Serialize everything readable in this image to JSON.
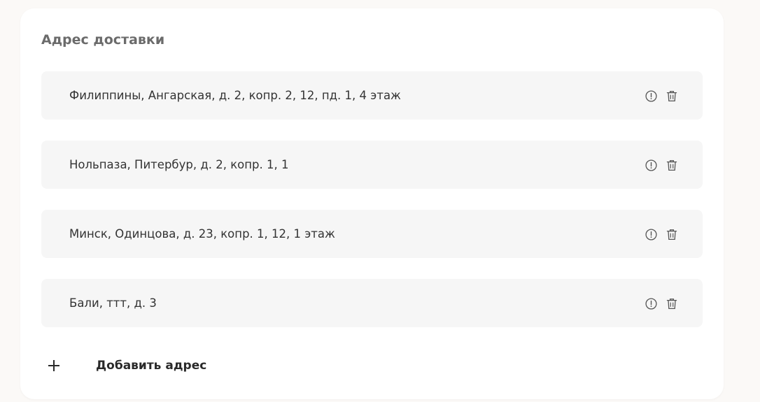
{
  "section": {
    "title": "Адрес доставки"
  },
  "addresses": [
    {
      "text": "Филиппины, Ангарская, д. 2, копр. 2, 12, пд. 1, 4 этаж"
    },
    {
      "text": "Нольпаза, Питербур, д. 2, копр. 1, 1"
    },
    {
      "text": "Минск, Одинцова, д. 23, копр. 1, 12, 1 этаж"
    },
    {
      "text": "Бали, ттт, д. 3"
    }
  ],
  "actions": {
    "info_icon": "info-circle-icon",
    "delete_icon": "trash-icon",
    "add_icon": "plus-icon",
    "add_label": "Добавить адрес"
  },
  "colors": {
    "page_background": "#fbf9f7",
    "card_background": "#ffffff",
    "item_background": "#f6f6f6",
    "title_text": "#6b6b6b",
    "body_text": "#333333",
    "icon_color": "#555555"
  }
}
